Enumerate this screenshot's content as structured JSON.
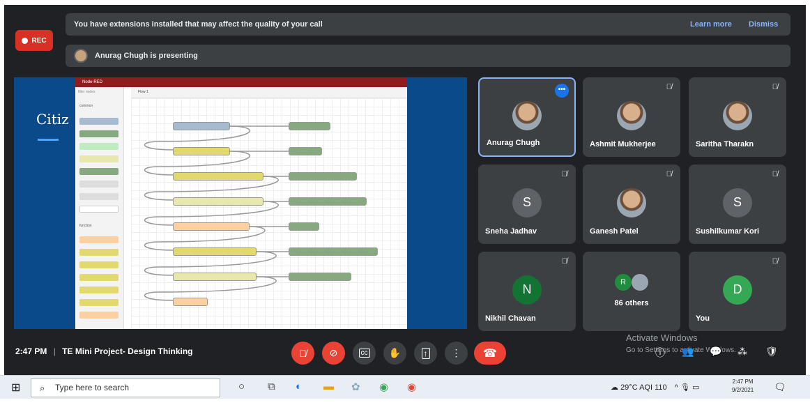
{
  "banner": {
    "extensions_message": "You have extensions installed that may affect the quality of your call",
    "learn_more": "Learn more",
    "dismiss": "Dismiss",
    "presenting": "Anurag Chugh is presenting"
  },
  "rec_label": "REC",
  "share": {
    "slide_title": "Citiz",
    "app_title": "Node-RED",
    "flow_tab": "Flow 1",
    "filter_placeholder": "filter nodes",
    "palette_headings": [
      "common",
      "function"
    ]
  },
  "participants": [
    {
      "name": "Anurag Chugh",
      "type": "photo",
      "highlighted": true
    },
    {
      "name": "Ashmit Mukherjee",
      "type": "photo"
    },
    {
      "name": "Saritha Tharakn",
      "type": "photo"
    },
    {
      "name": "Sneha Jadhav",
      "type": "letter",
      "letter": "S",
      "color": "#5f6368"
    },
    {
      "name": "Ganesh Patel",
      "type": "photo"
    },
    {
      "name": "Sushilkumar Kori",
      "type": "letter",
      "letter": "S",
      "color": "#5f6368"
    },
    {
      "name": "Nikhil Chavan",
      "type": "letter",
      "letter": "N",
      "color": "#137333"
    },
    {
      "name": "86 others",
      "type": "others",
      "letter": "R",
      "color": "#1e8e3e"
    },
    {
      "name": "You",
      "type": "letter",
      "letter": "D",
      "color": "#34a853"
    }
  ],
  "meeting": {
    "time": "2:47 PM",
    "separator": "|",
    "title": "TE Mini Project- Design Thinking"
  },
  "activate": {
    "line1": "Activate Windows",
    "line2": "Go to Settings to activate Windows."
  },
  "taskbar": {
    "search_placeholder": "Type here to search",
    "weather": "29°C",
    "aqi": "AQI 110",
    "time": "2:47 PM",
    "date": "9/2/2021"
  },
  "colors": {
    "meet_bg": "#202124",
    "tile_bg": "#3c4043",
    "accent": "#8ab4f8",
    "red": "#ea4335"
  }
}
